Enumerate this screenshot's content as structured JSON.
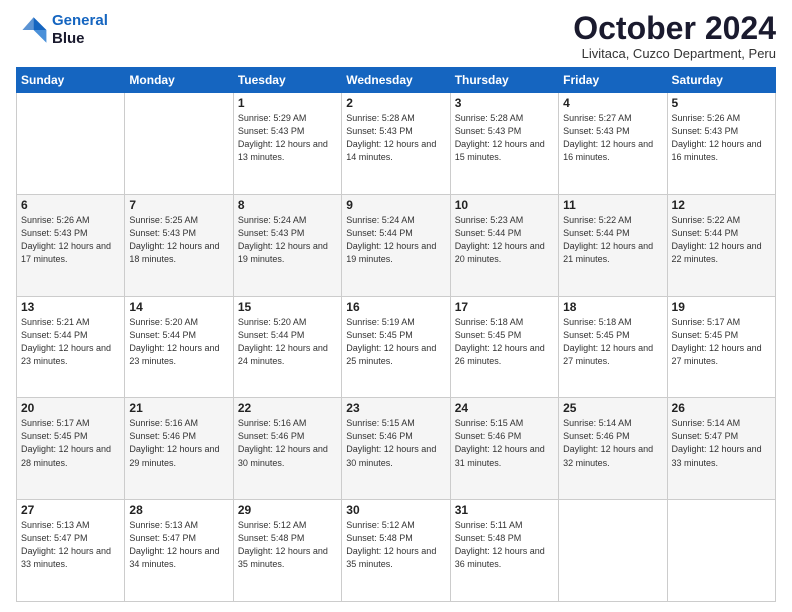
{
  "header": {
    "logo_line1": "General",
    "logo_line2": "Blue",
    "month": "October 2024",
    "location": "Livitaca, Cuzco Department, Peru"
  },
  "days_of_week": [
    "Sunday",
    "Monday",
    "Tuesday",
    "Wednesday",
    "Thursday",
    "Friday",
    "Saturday"
  ],
  "weeks": [
    [
      {
        "day": "",
        "info": ""
      },
      {
        "day": "",
        "info": ""
      },
      {
        "day": "1",
        "info": "Sunrise: 5:29 AM\nSunset: 5:43 PM\nDaylight: 12 hours and 13 minutes."
      },
      {
        "day": "2",
        "info": "Sunrise: 5:28 AM\nSunset: 5:43 PM\nDaylight: 12 hours and 14 minutes."
      },
      {
        "day": "3",
        "info": "Sunrise: 5:28 AM\nSunset: 5:43 PM\nDaylight: 12 hours and 15 minutes."
      },
      {
        "day": "4",
        "info": "Sunrise: 5:27 AM\nSunset: 5:43 PM\nDaylight: 12 hours and 16 minutes."
      },
      {
        "day": "5",
        "info": "Sunrise: 5:26 AM\nSunset: 5:43 PM\nDaylight: 12 hours and 16 minutes."
      }
    ],
    [
      {
        "day": "6",
        "info": "Sunrise: 5:26 AM\nSunset: 5:43 PM\nDaylight: 12 hours and 17 minutes."
      },
      {
        "day": "7",
        "info": "Sunrise: 5:25 AM\nSunset: 5:43 PM\nDaylight: 12 hours and 18 minutes."
      },
      {
        "day": "8",
        "info": "Sunrise: 5:24 AM\nSunset: 5:43 PM\nDaylight: 12 hours and 19 minutes."
      },
      {
        "day": "9",
        "info": "Sunrise: 5:24 AM\nSunset: 5:44 PM\nDaylight: 12 hours and 19 minutes."
      },
      {
        "day": "10",
        "info": "Sunrise: 5:23 AM\nSunset: 5:44 PM\nDaylight: 12 hours and 20 minutes."
      },
      {
        "day": "11",
        "info": "Sunrise: 5:22 AM\nSunset: 5:44 PM\nDaylight: 12 hours and 21 minutes."
      },
      {
        "day": "12",
        "info": "Sunrise: 5:22 AM\nSunset: 5:44 PM\nDaylight: 12 hours and 22 minutes."
      }
    ],
    [
      {
        "day": "13",
        "info": "Sunrise: 5:21 AM\nSunset: 5:44 PM\nDaylight: 12 hours and 23 minutes."
      },
      {
        "day": "14",
        "info": "Sunrise: 5:20 AM\nSunset: 5:44 PM\nDaylight: 12 hours and 23 minutes."
      },
      {
        "day": "15",
        "info": "Sunrise: 5:20 AM\nSunset: 5:44 PM\nDaylight: 12 hours and 24 minutes."
      },
      {
        "day": "16",
        "info": "Sunrise: 5:19 AM\nSunset: 5:45 PM\nDaylight: 12 hours and 25 minutes."
      },
      {
        "day": "17",
        "info": "Sunrise: 5:18 AM\nSunset: 5:45 PM\nDaylight: 12 hours and 26 minutes."
      },
      {
        "day": "18",
        "info": "Sunrise: 5:18 AM\nSunset: 5:45 PM\nDaylight: 12 hours and 27 minutes."
      },
      {
        "day": "19",
        "info": "Sunrise: 5:17 AM\nSunset: 5:45 PM\nDaylight: 12 hours and 27 minutes."
      }
    ],
    [
      {
        "day": "20",
        "info": "Sunrise: 5:17 AM\nSunset: 5:45 PM\nDaylight: 12 hours and 28 minutes."
      },
      {
        "day": "21",
        "info": "Sunrise: 5:16 AM\nSunset: 5:46 PM\nDaylight: 12 hours and 29 minutes."
      },
      {
        "day": "22",
        "info": "Sunrise: 5:16 AM\nSunset: 5:46 PM\nDaylight: 12 hours and 30 minutes."
      },
      {
        "day": "23",
        "info": "Sunrise: 5:15 AM\nSunset: 5:46 PM\nDaylight: 12 hours and 30 minutes."
      },
      {
        "day": "24",
        "info": "Sunrise: 5:15 AM\nSunset: 5:46 PM\nDaylight: 12 hours and 31 minutes."
      },
      {
        "day": "25",
        "info": "Sunrise: 5:14 AM\nSunset: 5:46 PM\nDaylight: 12 hours and 32 minutes."
      },
      {
        "day": "26",
        "info": "Sunrise: 5:14 AM\nSunset: 5:47 PM\nDaylight: 12 hours and 33 minutes."
      }
    ],
    [
      {
        "day": "27",
        "info": "Sunrise: 5:13 AM\nSunset: 5:47 PM\nDaylight: 12 hours and 33 minutes."
      },
      {
        "day": "28",
        "info": "Sunrise: 5:13 AM\nSunset: 5:47 PM\nDaylight: 12 hours and 34 minutes."
      },
      {
        "day": "29",
        "info": "Sunrise: 5:12 AM\nSunset: 5:48 PM\nDaylight: 12 hours and 35 minutes."
      },
      {
        "day": "30",
        "info": "Sunrise: 5:12 AM\nSunset: 5:48 PM\nDaylight: 12 hours and 35 minutes."
      },
      {
        "day": "31",
        "info": "Sunrise: 5:11 AM\nSunset: 5:48 PM\nDaylight: 12 hours and 36 minutes."
      },
      {
        "day": "",
        "info": ""
      },
      {
        "day": "",
        "info": ""
      }
    ]
  ]
}
